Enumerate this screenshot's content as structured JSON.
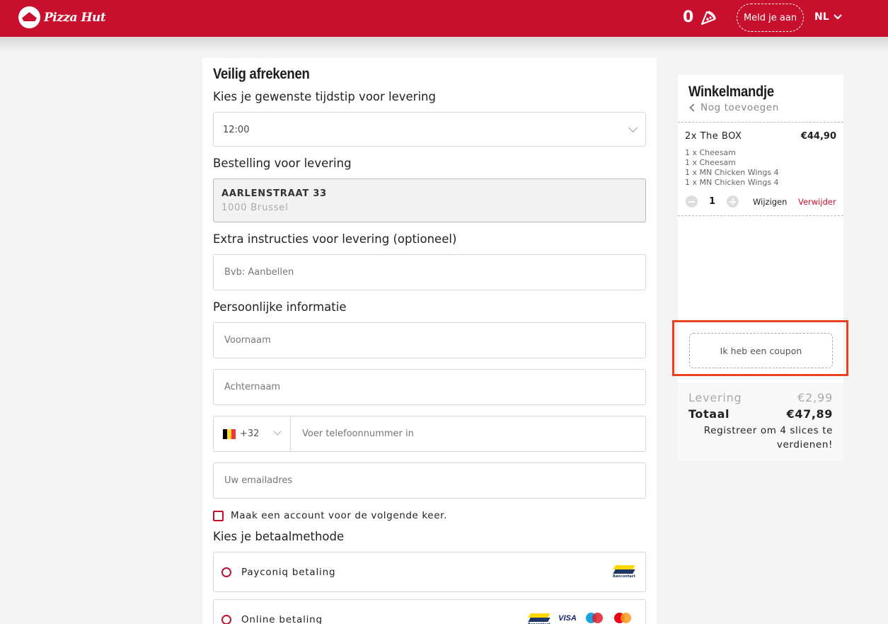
{
  "header": {
    "brand": "Pizza Hut",
    "cart_count": "0",
    "login_label": "Meld je aan",
    "language": "NL",
    "brand_color": "#c8102e"
  },
  "checkout": {
    "title": "Veilig afrekenen",
    "time_section": "Kies je gewenste tijdstip voor levering",
    "time_value": "12:00",
    "delivery_section": "Bestelling voor levering",
    "address_street": "AARLENSTRAAT 33",
    "address_city": "1000 Brussel",
    "instructions_section": "Extra instructies voor levering (optioneel)",
    "instructions_placeholder": "Bvb: Aanbellen",
    "personal_section": "Persoonlijke informatie",
    "firstname_placeholder": "Voornaam",
    "lastname_placeholder": "Achternaam",
    "dial_code": "+32",
    "phone_placeholder": "Voer telefoonnummer in",
    "email_placeholder": "Uw emailadres",
    "create_account_label": "Maak een account voor de volgende keer.",
    "payment_section": "Kies je betaalmethode",
    "payment_options": [
      {
        "label": "Payconiq betaling",
        "icons": [
          "bancontact-icon"
        ]
      },
      {
        "label": "Online betaling",
        "icons": [
          "bancontact-icon",
          "visa-icon",
          "maestro-icon",
          "mastercard-icon"
        ]
      }
    ],
    "bancontact_text": "Bancontact",
    "visa_text": "VISA"
  },
  "cart": {
    "title": "Winkelmandje",
    "add_more": "Nog toevoegen",
    "item": {
      "name": "2x The BOX",
      "price": "€44,90",
      "sub_items": [
        "1 x Cheesam",
        "1 x Cheesam",
        "1 x MN Chicken Wings 4",
        "1 x MN Chicken Wings 4"
      ],
      "quantity": "1",
      "edit_label": "Wijzigen",
      "remove_label": "Verwijder"
    },
    "coupon_label": "Ik heb een coupon",
    "delivery_label": "Levering",
    "delivery_price": "€2,99",
    "total_label": "Totaal",
    "total_price": "€47,89",
    "promo_text": "Registreer om 4 slices te verdienen!"
  }
}
